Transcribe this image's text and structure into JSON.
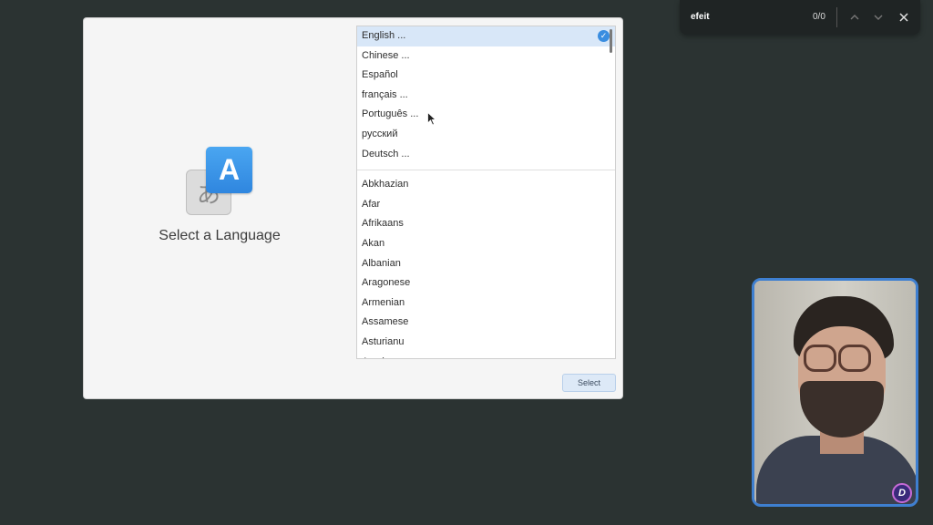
{
  "find_bar": {
    "query": "efeit",
    "match_count": "0/0",
    "icons": [
      "chevron-up-icon",
      "chevron-down-icon",
      "close-icon"
    ]
  },
  "dialog": {
    "title": "Select a Language",
    "icon_glyphs": {
      "front": "A",
      "back": "あ"
    },
    "select_button_label": "Select",
    "common_languages": [
      {
        "label": "English ...",
        "selected": true
      },
      {
        "label": "Chinese ...",
        "selected": false
      },
      {
        "label": "Español",
        "selected": false
      },
      {
        "label": "français ...",
        "selected": false
      },
      {
        "label": "Português ...",
        "selected": false
      },
      {
        "label": "русский",
        "selected": false
      },
      {
        "label": "Deutsch ...",
        "selected": false
      }
    ],
    "all_languages": [
      "Abkhazian",
      "Afar",
      "Afrikaans",
      "Akan",
      "Albanian",
      "Aragonese",
      "Armenian",
      "Assamese",
      "Asturianu",
      "Avaric"
    ]
  },
  "colors": {
    "background": "#2b3332",
    "accent": "#3a8de0",
    "webcam_border": "#3e7fd0"
  },
  "webcam": {
    "logo_text": "D"
  }
}
